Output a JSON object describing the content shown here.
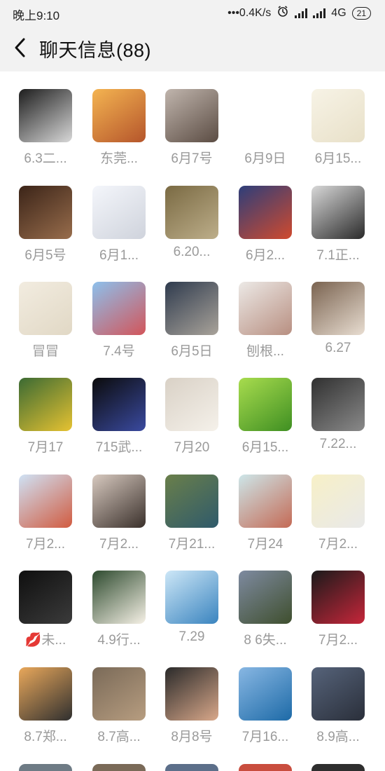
{
  "status_bar": {
    "time": "晚上9:10",
    "net_speed": "•••0.4K/s",
    "network": "4G",
    "battery": "21"
  },
  "header": {
    "back_icon": "chevron-left-icon",
    "title": "聊天信息(88)"
  },
  "items": [
    {
      "label": "6.3二...",
      "colors": [
        "#1d1d1d",
        "#d8d8d8"
      ]
    },
    {
      "label": "东莞...",
      "colors": [
        "#f4b451",
        "#b5552b"
      ]
    },
    {
      "label": "6月7号",
      "colors": [
        "#c0b5ad",
        "#5b4c43"
      ]
    },
    {
      "label": "6月9日",
      "colors": []
    },
    {
      "label": "6月15...",
      "colors": [
        "#f7f3e6",
        "#e8e0c8"
      ]
    },
    {
      "label": "6月5号",
      "colors": [
        "#3b2418",
        "#986d4c"
      ]
    },
    {
      "label": "6月1...",
      "colors": [
        "#f4f6fb",
        "#cfd3dc"
      ]
    },
    {
      "label": "6.20...",
      "colors": [
        "#7a6a43",
        "#bdae8a"
      ]
    },
    {
      "label": "6月2...",
      "colors": [
        "#2d3e7a",
        "#d04a2e"
      ]
    },
    {
      "label": "7.1正...",
      "colors": [
        "#d8d8d8",
        "#2a2a2a"
      ]
    },
    {
      "label": "冒冒",
      "colors": [
        "#f2ece0",
        "#e1d8c5"
      ]
    },
    {
      "label": "7.4号",
      "colors": [
        "#8dc0ec",
        "#d2555a"
      ]
    },
    {
      "label": "6月5日",
      "colors": [
        "#2f3b4e",
        "#a9a39a"
      ]
    },
    {
      "label": "刨根...",
      "colors": [
        "#ece9e6",
        "#b88f81"
      ]
    },
    {
      "label": "6.27",
      "colors": [
        "#7a6350",
        "#e8ddd1"
      ]
    },
    {
      "label": "7月17",
      "colors": [
        "#3b6a33",
        "#e6c232"
      ]
    },
    {
      "label": "715武...",
      "colors": [
        "#0b0b0b",
        "#3a4aa0"
      ]
    },
    {
      "label": "7月20",
      "colors": [
        "#d9d1c6",
        "#f5f1ea"
      ]
    },
    {
      "label": "6月15...",
      "colors": [
        "#a8dc4e",
        "#3f8f22"
      ]
    },
    {
      "label": "7.22...",
      "colors": [
        "#303030",
        "#8a8a8a"
      ]
    },
    {
      "label": "7月2...",
      "colors": [
        "#cfe2f5",
        "#d15b40"
      ]
    },
    {
      "label": "7月2...",
      "colors": [
        "#d7c9bf",
        "#3a302b"
      ]
    },
    {
      "label": "7月21...",
      "colors": [
        "#6a7f4a",
        "#2f5a6b"
      ]
    },
    {
      "label": "7月24",
      "colors": [
        "#cde6e9",
        "#c46a55"
      ]
    },
    {
      "label": "7月2...",
      "colors": [
        "#f7f0c7",
        "#e9e9e9"
      ]
    },
    {
      "label": "💋未...",
      "colors": [
        "#0f0f0f",
        "#3b3b3b"
      ]
    },
    {
      "label": "4.9行...",
      "colors": [
        "#2d4a2e",
        "#f6f1e6"
      ]
    },
    {
      "label": "7.29",
      "colors": [
        "#cde7f7",
        "#3a84bf"
      ]
    },
    {
      "label": "8 6失...",
      "colors": [
        "#7e8aa0",
        "#3f4f2e"
      ]
    },
    {
      "label": "7月2...",
      "colors": [
        "#1a1a1a",
        "#c6263a"
      ]
    },
    {
      "label": "8.7郑...",
      "colors": [
        "#e9a85b",
        "#2f2f2f"
      ]
    },
    {
      "label": "8.7高...",
      "colors": [
        "#7a6a58",
        "#b79d80"
      ]
    },
    {
      "label": "8月8号",
      "colors": [
        "#2a2a2a",
        "#d9a88a"
      ]
    },
    {
      "label": "7月16...",
      "colors": [
        "#88b7e3",
        "#1d6aa7"
      ]
    },
    {
      "label": "8.9高...",
      "colors": [
        "#56637a",
        "#2a2f3a"
      ]
    }
  ]
}
